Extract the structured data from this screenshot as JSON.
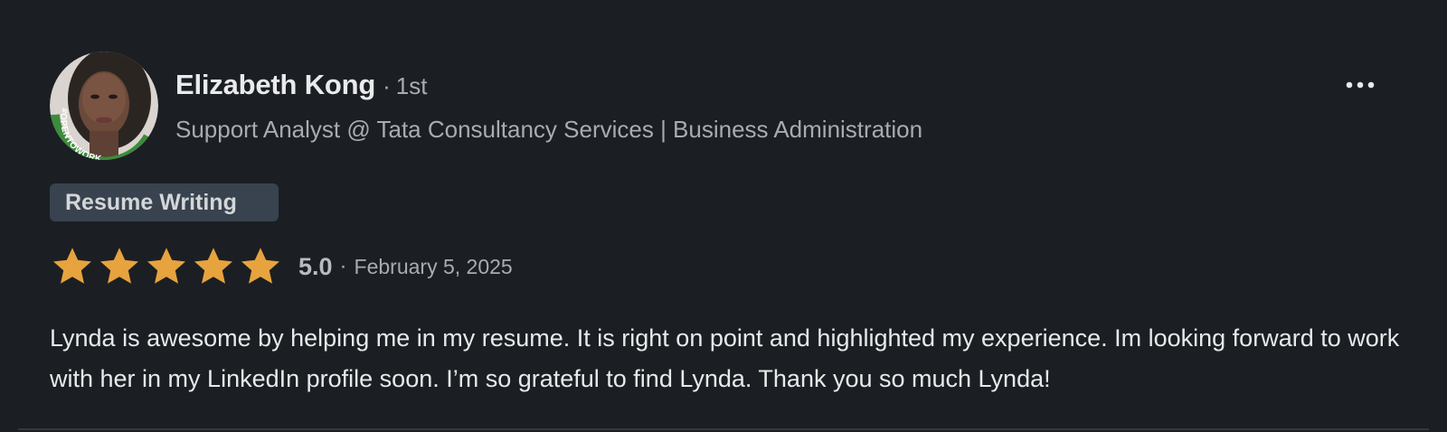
{
  "reviewer": {
    "name": "Elizabeth Kong",
    "separator": "·",
    "degree": "1st",
    "headline": "Support Analyst @ Tata Consultancy Services | Business Administration",
    "avatar_badge": "#OPENTOWORK"
  },
  "actions": {
    "more_icon": "ellipsis-icon"
  },
  "service": {
    "tag": "Resume Writing"
  },
  "rating": {
    "stars": 5,
    "max_stars": 5,
    "value": "5.0",
    "separator": "·",
    "date": "February 5, 2025"
  },
  "review": {
    "text": "Lynda is awesome by helping me in my resume. It is right on point and highlighted my experience. Im looking forward to work with her in my LinkedIn profile soon. I’m so grateful to find Lynda. Thank you so much Lynda!"
  },
  "colors": {
    "background": "#1b1f23",
    "star": "#e7a33e",
    "tag_background": "#38434f",
    "open_to_work_ring": "#3d8b3d"
  }
}
